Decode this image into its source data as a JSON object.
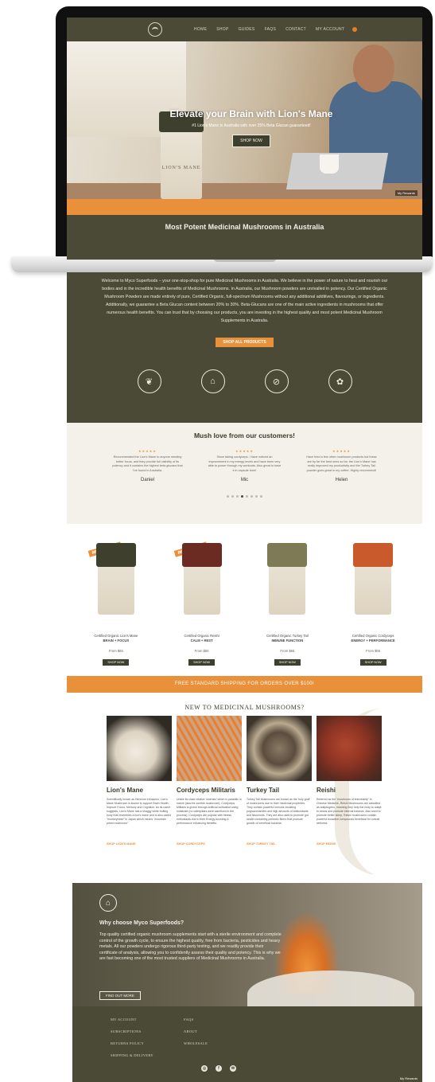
{
  "nav": {
    "items": [
      "HOME",
      "SHOP",
      "GUIDES",
      "FAQS",
      "CONTACT",
      "MY ACCOUNT"
    ]
  },
  "hero": {
    "title": "Elevate your Brain with Lion's Mane",
    "subtitle": "#1 Lion's Mane in Australia with over 25% Beta Glucan guaranteed!",
    "button": "SHOP NOW",
    "jar_label": "LION'S MANE",
    "badge": "My Rewards"
  },
  "intro": {
    "heading": "Most Potent Medicinal Mushrooms in Australia",
    "text": "Welcome to Myco Superfoods – your one-stop-shop for pure Medicinal Mushrooms in Australia. We believe in the power of nature to heal and nourish our bodies and in the incredible health benefits of Medicinal Mushrooms. In Australia, our Mushroom powders are unrivalled in potency. Our Certified Organic Mushroom Powders are made entirely of pure, Certified Organic, full-spectrum Mushrooms without any additional additives, flavourings, or ingredients. Additionally, we guarantee a Beta Glucan content between 20% to 30%. Beta-Glucans are one of the main active ingredients in mushrooms that offer numerous health benefits. You can trust that by choosing our products, you are investing in the highest quality and most potent Medicinal Mushroom Supplements in Australia.",
    "button": "SHOP ALL PRODUCTS",
    "badges": [
      "leaf-icon",
      "mushroom-icon",
      "no-gmo-icon",
      "organic-icon"
    ]
  },
  "reviews": {
    "title": "Mush love from our customers!",
    "stars": "★★★★★",
    "items": [
      {
        "text": "Recommended the Lion's Mane to anyone needing better focus, and they provide full visibility of its potency and it contains the highest beta glucans that I've found in Australia.",
        "name": "Daniel"
      },
      {
        "text": "Since taking cordyceps, I have noticed an improvement in my energy levels and have been very able to power through my workouts. Also great to have it in capsule form!",
        "name": "Mic"
      },
      {
        "text": "Have tried a few other mushroom products but these are by far the best ones so far. the Lion's Mane has really improved my productivity and the Turkey Tail powder goes great in my coffee. Highly recommend!",
        "name": "Helen"
      }
    ]
  },
  "products": [
    {
      "tag": "BEST SELLER",
      "name": "Certified Organic Lion's Mane",
      "sub": "BRAIN + FOCUS",
      "price": "From $65",
      "button": "SHOP NOW",
      "lid": "#3f3f2e"
    },
    {
      "tag": "BEST SELLER",
      "name": "Certified Organic Reishi",
      "sub": "CALM + REST",
      "price": "From $65",
      "button": "SHOP NOW",
      "lid": "#6b2a22"
    },
    {
      "tag": "",
      "name": "Certified Organic Turkey Tail",
      "sub": "IMMUNE FUNCTION",
      "price": "From $65",
      "button": "SHOP NOW",
      "lid": "#7d7a55"
    },
    {
      "tag": "",
      "name": "Certified Organic Cordyceps",
      "sub": "ENERGY + PERFORMANCE",
      "price": "From $65",
      "button": "SHOP NOW",
      "lid": "#c95a2c"
    }
  ],
  "shipping": {
    "text": "FREE STANDARD SHIPPING FOR ORDERS OVER $100!"
  },
  "new_section": {
    "title": "NEW TO MEDICINAL MUSHROOMS?",
    "cards": [
      {
        "name": "Lion's Mane",
        "text": "Scientifically known as Hericium erinaceus, Lion's Mane Mushroom is known to support Brain Health, improve Focus, Memory and Cognition. As its name suggests, Lion's Mane has a shaggy white fruiting body that resembles a lion's mane and is also called \"monkeyhead\" in Japan which means \"mountain priest mushroom\".",
        "link": "SHOP LION'S MANE",
        "color": "#e6e0d2"
      },
      {
        "name": "Cordyceps Militaris",
        "text": "Unlike its close relative 'sinensis' which is parasitic in nature (aka the zombie mushroom), Cordyceps Militaris is grown through artificial cultivation using substrate (no caterpillars were sacrificed in the process). Cordyceps are popular with fitness enthusiasts due to their Energy boosting & performance enhancing benefits.",
        "link": "SHOP CORDYCEPS",
        "color": "#e2813a"
      },
      {
        "name": "Turkey Tail",
        "text": "Turkey Tail Mushrooms are known as the 'holy grail' of mushrooms due to their medicinal properties. They contain powerful immune-boosting polysaccharides and high amounts of antioxidants and flavonoids. They are also used to promote gut health containing prebiotic fibers that promote growth of beneficial bacteria.",
        "link": "SHOP TURKEY TAIL",
        "color": "#6d5d4f"
      },
      {
        "name": "Reishi",
        "text": "Referred as the \"mushroom of immortality\" in Chinese Medicine, Reishi Mushrooms are classified as adaptogens, meaning they help the body to adapt to stress and promote internal balance. Also used to promote better sleep, Reishi mushrooms contain powerful bioactive compounds beneficial for overall wellness.",
        "link": "SHOP REISHI",
        "color": "#9a3a2a"
      }
    ]
  },
  "why": {
    "title": "Why choose Myco Superfoods?",
    "text": "Top quality certified organic mushroom supplements start with a sterile environment and complete control of the growth cycle, to ensure the highest quality, free from bacteria, pesticides and heavy metals. All our powders undergo rigorous third-party testing, and we readily provide their certificate of analysis, allowing you to confidently assess their quality and potency. This is why we are fast becoming one of the most trusted suppliers of Medicinal Mushrooms in Australia.",
    "button": "FIND OUT MORE"
  },
  "footer": {
    "links": [
      "MY ACCOUNT",
      "FAQS",
      "SUBSCRIPTIONS",
      "ABOUT",
      "RETURNS POLICY",
      "WHOLESALE",
      "SHIPPING & DELIVERY"
    ],
    "social": [
      "instagram-icon",
      "facebook-icon",
      "email-icon"
    ],
    "badge": "My Rewards"
  }
}
